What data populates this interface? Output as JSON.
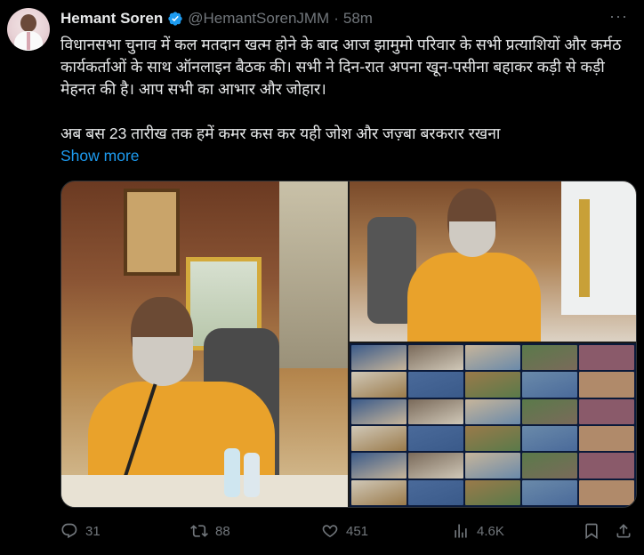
{
  "tweet": {
    "author": {
      "name": "Hemant Soren",
      "handle": "@HemantSorenJMM"
    },
    "separator": "·",
    "time": "58m",
    "text_p1": "विधानसभा चुनाव में कल मतदान खत्म होने के बाद आज झामुमो परिवार के सभी प्रत्याशियों और कर्मठ कार्यकर्ताओं के साथ ऑनलाइन बैठक की। सभी ने दिन-रात अपना खून-पसीना बहाकर कड़ी से कड़ी मेहनत की है। आप सभी का आभार और जोहार।",
    "text_p2": "अब बस 23 तारीख तक हमें कमर कस कर यही जोश और जज़्बा बरकरार रखना",
    "show_more": "Show more",
    "more_glyph": "···"
  },
  "actions": {
    "replies": "31",
    "reposts": "88",
    "likes": "451",
    "views": "4.6K"
  },
  "colors": {
    "background": "#000000",
    "text": "#e7e9ea",
    "secondary": "#71767b",
    "link": "#1d9bf0",
    "verified": "#1d9bf0"
  },
  "icons": {
    "verified": "verified-badge-icon",
    "more": "more-options-icon",
    "reply": "reply-icon",
    "repost": "repost-icon",
    "like": "heart-icon",
    "views": "views-chart-icon",
    "bookmark": "bookmark-icon",
    "share": "share-icon"
  }
}
